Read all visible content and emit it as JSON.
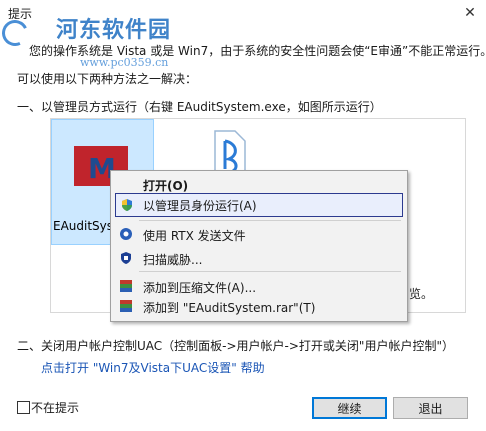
{
  "window": {
    "title": "提示",
    "close_glyph": "✕"
  },
  "watermark": {
    "name": "河东软件园",
    "url": "www.pc0359.cn"
  },
  "intro": {
    "line1": "您的操作系统是 Vista 或是 Win7，由于系统的安全性问题会使“E审通”不能正常运行。",
    "line2": "可以使用以下两种方法之一解决："
  },
  "method1": {
    "heading": "一、以管理员方式运行（右键 EAuditSystem.exe，如图所示运行）"
  },
  "screenshot": {
    "file_label": "EAuditSys",
    "trailing_text": "览。",
    "context_menu": [
      {
        "label": "打开(O)",
        "bold": true,
        "icon": ""
      },
      {
        "label": "以管理员身份运行(A)",
        "highlighted": true,
        "icon": "shield-icon"
      },
      {
        "label": "使用 RTX 发送文件",
        "icon": "rtx-icon"
      },
      {
        "label": "扫描威胁...",
        "icon": "defender-icon"
      },
      {
        "label": "添加到压缩文件(A)...",
        "icon": "archive-icon"
      },
      {
        "label": "添加到 \"EAuditSystem.rar\"(T)",
        "icon": "archive-icon"
      }
    ]
  },
  "method2": {
    "heading": "二、关闭用户帐户控制UAC（控制面板->用户帐户->打开或关闭\"用户帐户控制\"）",
    "help_link": "点击打开 \"Win7及Vista下UAC设置\" 帮助"
  },
  "footer": {
    "dont_show_label": "不在提示",
    "continue_label": "继续",
    "exit_label": "退出"
  }
}
